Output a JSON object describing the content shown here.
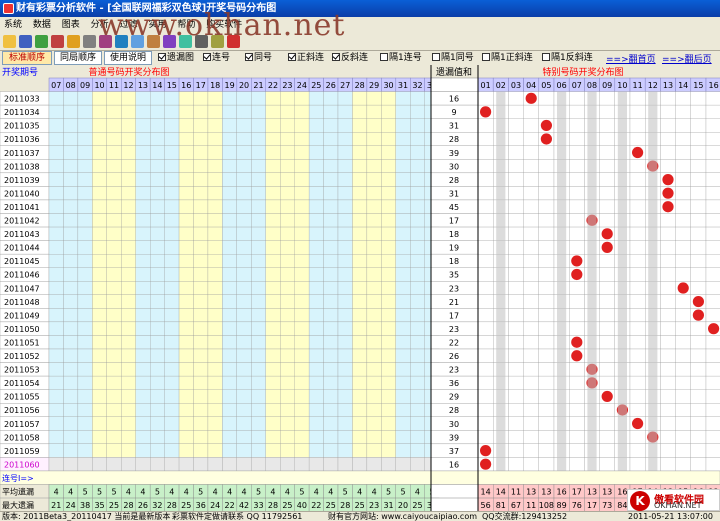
{
  "window": {
    "title": "财有彩票分析软件 - [全国联网福彩双色球]开奖号码分布图"
  },
  "watermark": "www.okhan.net",
  "menu": [
    "系统",
    "数据",
    "图表",
    "分析",
    "过滤",
    "实用",
    "帮助",
    "购买软件"
  ],
  "tabs": {
    "standard": "标准顺序",
    "same_period": "同局顺序",
    "help": "使用说明"
  },
  "options": [
    {
      "label": "遗漏图",
      "checked": true
    },
    {
      "label": "连号",
      "checked": true
    },
    {
      "label": "同号",
      "checked": true
    },
    {
      "label": "正斜连",
      "checked": true
    },
    {
      "label": "反斜连",
      "checked": true
    },
    {
      "label": "隔1连号",
      "checked": false
    },
    {
      "label": "隔1同号",
      "checked": false
    },
    {
      "label": "隔1正斜连",
      "checked": false
    },
    {
      "label": "隔1反斜连",
      "checked": false
    }
  ],
  "nav": {
    "first": "==>翻首页",
    "last": "==>翻后页"
  },
  "grid": {
    "period_header": "开奖期号",
    "red_header": "普通号码开奖分布图",
    "omit_header": "遗漏值和",
    "blue_header": "特别号码开奖分布图",
    "red_numbers": [
      "07",
      "08",
      "09",
      "10",
      "11",
      "12",
      "13",
      "14",
      "15",
      "16",
      "17",
      "18",
      "19",
      "20",
      "21",
      "22",
      "23",
      "24",
      "25",
      "26",
      "27",
      "28",
      "29",
      "30",
      "31",
      "32",
      "33"
    ],
    "blue_numbers": [
      "01",
      "02",
      "03",
      "04",
      "05",
      "06",
      "07",
      "08",
      "09",
      "10",
      "11",
      "12",
      "13",
      "14",
      "15",
      "16"
    ],
    "rows": [
      {
        "p": "2011033",
        "o": "16",
        "b": 4
      },
      {
        "p": "2011034",
        "o": "9",
        "b": 1
      },
      {
        "p": "2011035",
        "o": "31",
        "b": 5
      },
      {
        "p": "2011036",
        "o": "28",
        "b": 5
      },
      {
        "p": "2011037",
        "o": "39",
        "b": 11
      },
      {
        "p": "2011038",
        "o": "30",
        "b": 12
      },
      {
        "p": "2011039",
        "o": "28",
        "b": 13
      },
      {
        "p": "2011040",
        "o": "31",
        "b": 13
      },
      {
        "p": "2011041",
        "o": "45",
        "b": 13
      },
      {
        "p": "2011042",
        "o": "17",
        "b": 8
      },
      {
        "p": "2011043",
        "o": "18",
        "b": 9
      },
      {
        "p": "2011044",
        "o": "19",
        "b": 9
      },
      {
        "p": "2011045",
        "o": "18",
        "b": 7
      },
      {
        "p": "2011046",
        "o": "35",
        "b": 7
      },
      {
        "p": "2011047",
        "o": "23",
        "b": 14
      },
      {
        "p": "2011048",
        "o": "21",
        "b": 15
      },
      {
        "p": "2011049",
        "o": "17",
        "b": 15
      },
      {
        "p": "2011050",
        "o": "23",
        "b": 16
      },
      {
        "p": "2011051",
        "o": "22",
        "b": 7
      },
      {
        "p": "2011052",
        "o": "26",
        "b": 7
      },
      {
        "p": "2011053",
        "o": "23",
        "b": 8
      },
      {
        "p": "2011054",
        "o": "36",
        "b": 8
      },
      {
        "p": "2011055",
        "o": "29",
        "b": 9
      },
      {
        "p": "2011056",
        "o": "28",
        "b": 10
      },
      {
        "p": "2011057",
        "o": "30",
        "b": 11
      },
      {
        "p": "2011058",
        "o": "39",
        "b": 12
      },
      {
        "p": "2011059",
        "o": "37",
        "b": 1
      },
      {
        "p": "2011060",
        "o": "16",
        "b": 1
      }
    ],
    "footer": {
      "label_lianhao": "连号Ⅰ=>",
      "label_avg": "平均遗漏",
      "label_max": "最大遗漏",
      "avg_red": [
        "4",
        "4",
        "5",
        "5",
        "5",
        "4",
        "4",
        "5",
        "4",
        "4",
        "5",
        "4",
        "4",
        "4",
        "5",
        "4",
        "4",
        "5",
        "4",
        "4",
        "5",
        "4",
        "4",
        "5",
        "5",
        "4",
        "5"
      ],
      "avg_blue": [
        "14",
        "14",
        "11",
        "13",
        "13",
        "16",
        "17",
        "13",
        "13",
        "16",
        "17",
        "14",
        "13",
        "15",
        "16",
        "12"
      ],
      "max_red": [
        "21",
        "24",
        "38",
        "35",
        "25",
        "28",
        "26",
        "32",
        "28",
        "25",
        "36",
        "24",
        "22",
        "42",
        "33",
        "28",
        "25",
        "40",
        "22",
        "25",
        "28",
        "25",
        "23",
        "31",
        "20",
        "25",
        "35"
      ],
      "max_blue": [
        "56",
        "81",
        "67",
        "11",
        "108",
        "89",
        "76",
        "17",
        "73",
        "84",
        "71",
        "94",
        "60",
        "67",
        "58",
        "80"
      ]
    }
  },
  "statusbar": {
    "version": "版本: 2011Beta3_20110417 当前是最新版本",
    "contact": "彩票软件定做请联系 QQ 11792561",
    "site": "财有官方网站: www.caiyoucaipiao.com",
    "qq": "QQ交流群:129413252",
    "date": "2011-05-21 13:07:00"
  },
  "logo": {
    "mark": "K",
    "name": "傲看软件园",
    "url": "OKHAN.NET"
  },
  "colors": {
    "red": "#e02020",
    "green": "#20a020",
    "pink": "#e030e0",
    "yellow": "#ffffc8",
    "cyan": "#d8f4fc",
    "gray": "#c0c0c0",
    "header_blue": "#ccccff"
  }
}
